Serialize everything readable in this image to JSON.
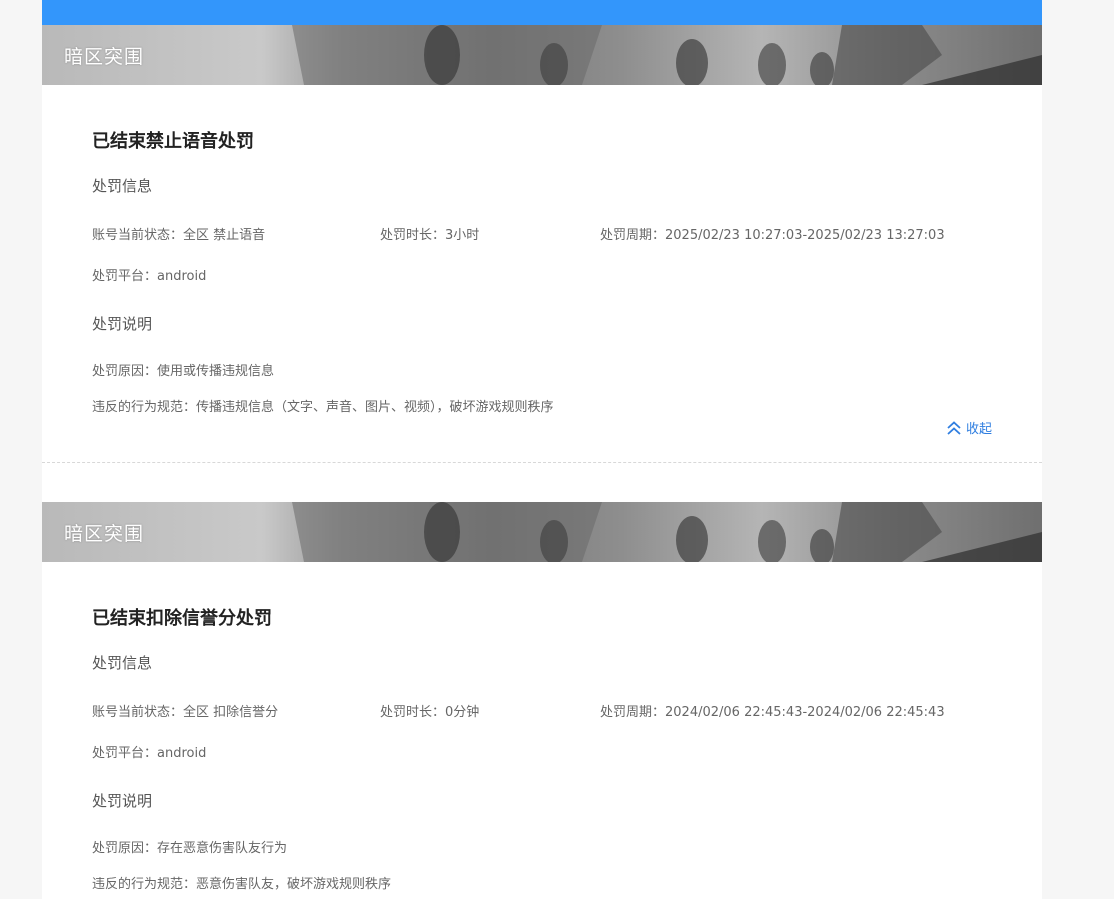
{
  "records": [
    {
      "game_name": "暗区突围",
      "status_title": "已结束禁止语音处罚",
      "info_section_title": "处罚信息",
      "account_status_label": "账号当前状态：",
      "account_status_value": "全区 禁止语音",
      "duration_label": "处罚时长：",
      "duration_value": "3小时",
      "period_label": "处罚周期：",
      "period_value": "2025/02/23 10:27:03-2025/02/23 13:27:03",
      "platform_label": "处罚平台：",
      "platform_value": "android",
      "desc_section_title": "处罚说明",
      "reason_label": "处罚原因：",
      "reason_value": "使用或传播违规信息",
      "rule_label": "违反的行为规范：",
      "rule_value": "传播违规信息（文字、声音、图片、视频），破坏游戏规则秩序",
      "collapse_label": "收起"
    },
    {
      "game_name": "暗区突围",
      "status_title": "已结束扣除信誉分处罚",
      "info_section_title": "处罚信息",
      "account_status_label": "账号当前状态：",
      "account_status_value": "全区 扣除信誉分",
      "duration_label": "处罚时长：",
      "duration_value": "0分钟",
      "period_label": "处罚周期：",
      "period_value": "2024/02/06 22:45:43-2024/02/06 22:45:43",
      "platform_label": "处罚平台：",
      "platform_value": "android",
      "desc_section_title": "处罚说明",
      "reason_label": "处罚原因：",
      "reason_value": "存在恶意伤害队友行为",
      "rule_label": "违反的行为规范：",
      "rule_value": "恶意伤害队友，破坏游戏规则秩序"
    }
  ],
  "colors": {
    "accent_bar": "#3396fb",
    "link": "#2f7ee0"
  },
  "icons": {
    "collapse": "double-chevron-up-icon"
  }
}
